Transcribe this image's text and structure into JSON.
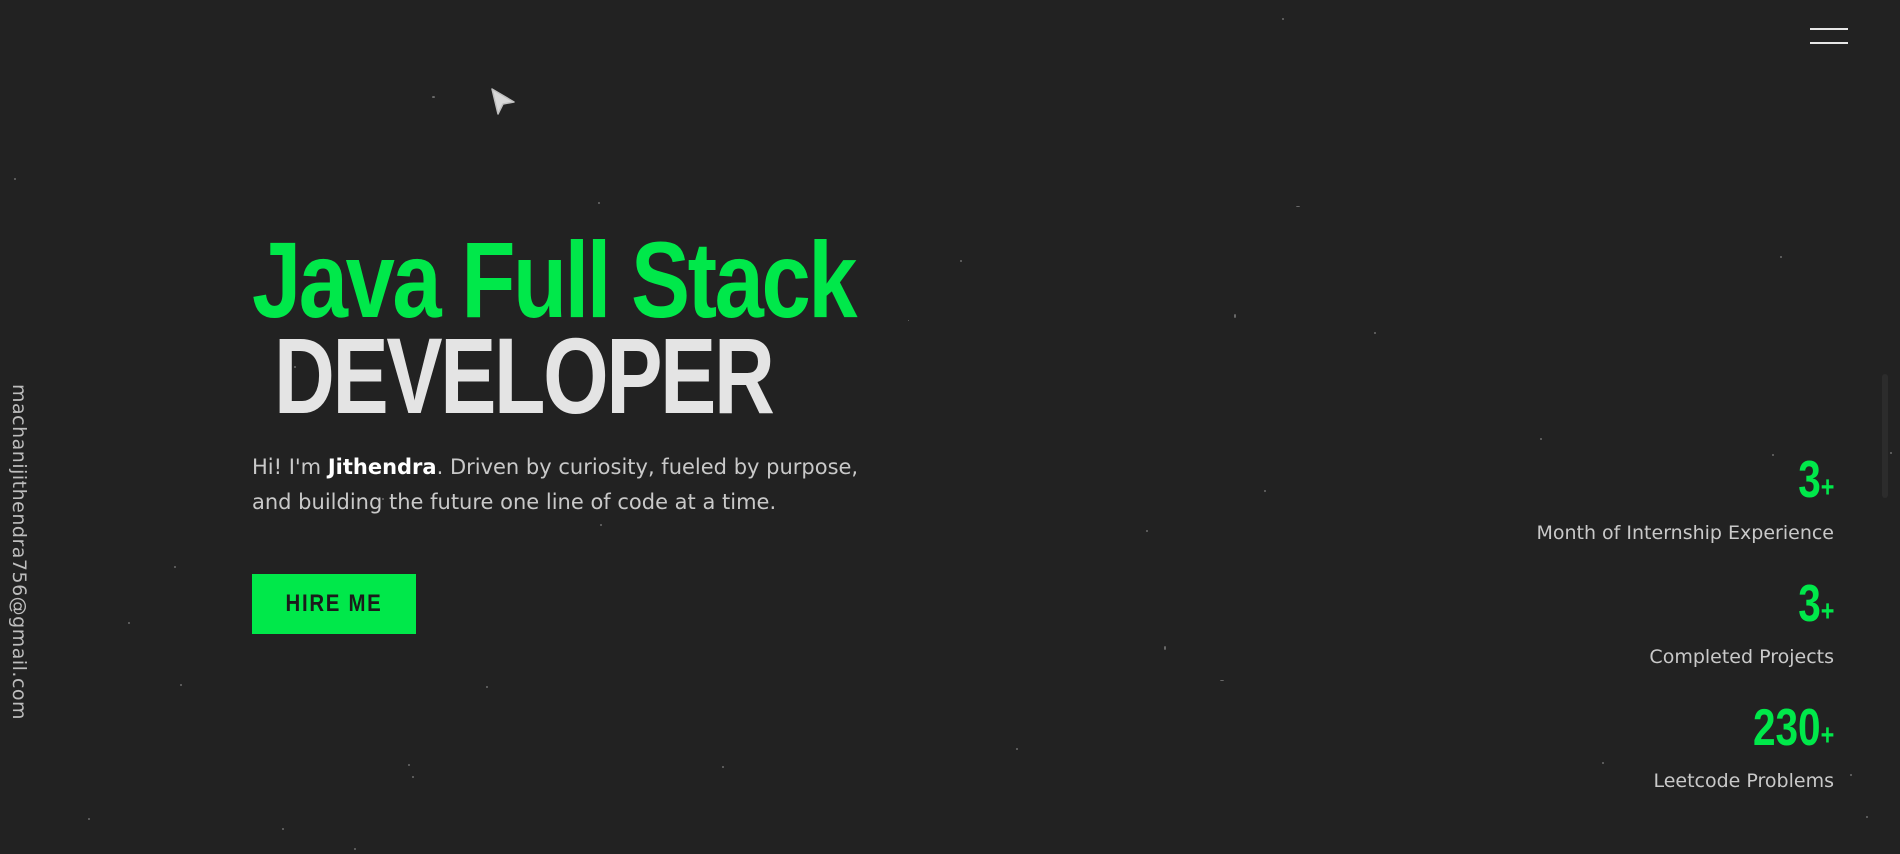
{
  "nav": {
    "menu_icon": "hamburger-menu-icon"
  },
  "hero": {
    "title_line1": "Java Full Stack",
    "title_line2": "DEVELOPER",
    "intro_prefix": "Hi! I'm ",
    "intro_name": "Jithendra",
    "intro_suffix": ". Driven by curiosity, fueled by purpose, and building the future one line of code at a time.",
    "hire_button_label": "HIRE ME"
  },
  "sidebar": {
    "email": "machanijithendra756@gmail.com"
  },
  "stats": [
    {
      "value": "3",
      "suffix": "+",
      "label": "Month of Internship Experience"
    },
    {
      "value": "3",
      "suffix": "+",
      "label": "Completed Projects"
    },
    {
      "value": "230",
      "suffix": "+",
      "label": "Leetcode Problems"
    }
  ],
  "colors": {
    "background": "#222222",
    "accent": "#00e84a",
    "text": "#c9c9c9"
  }
}
